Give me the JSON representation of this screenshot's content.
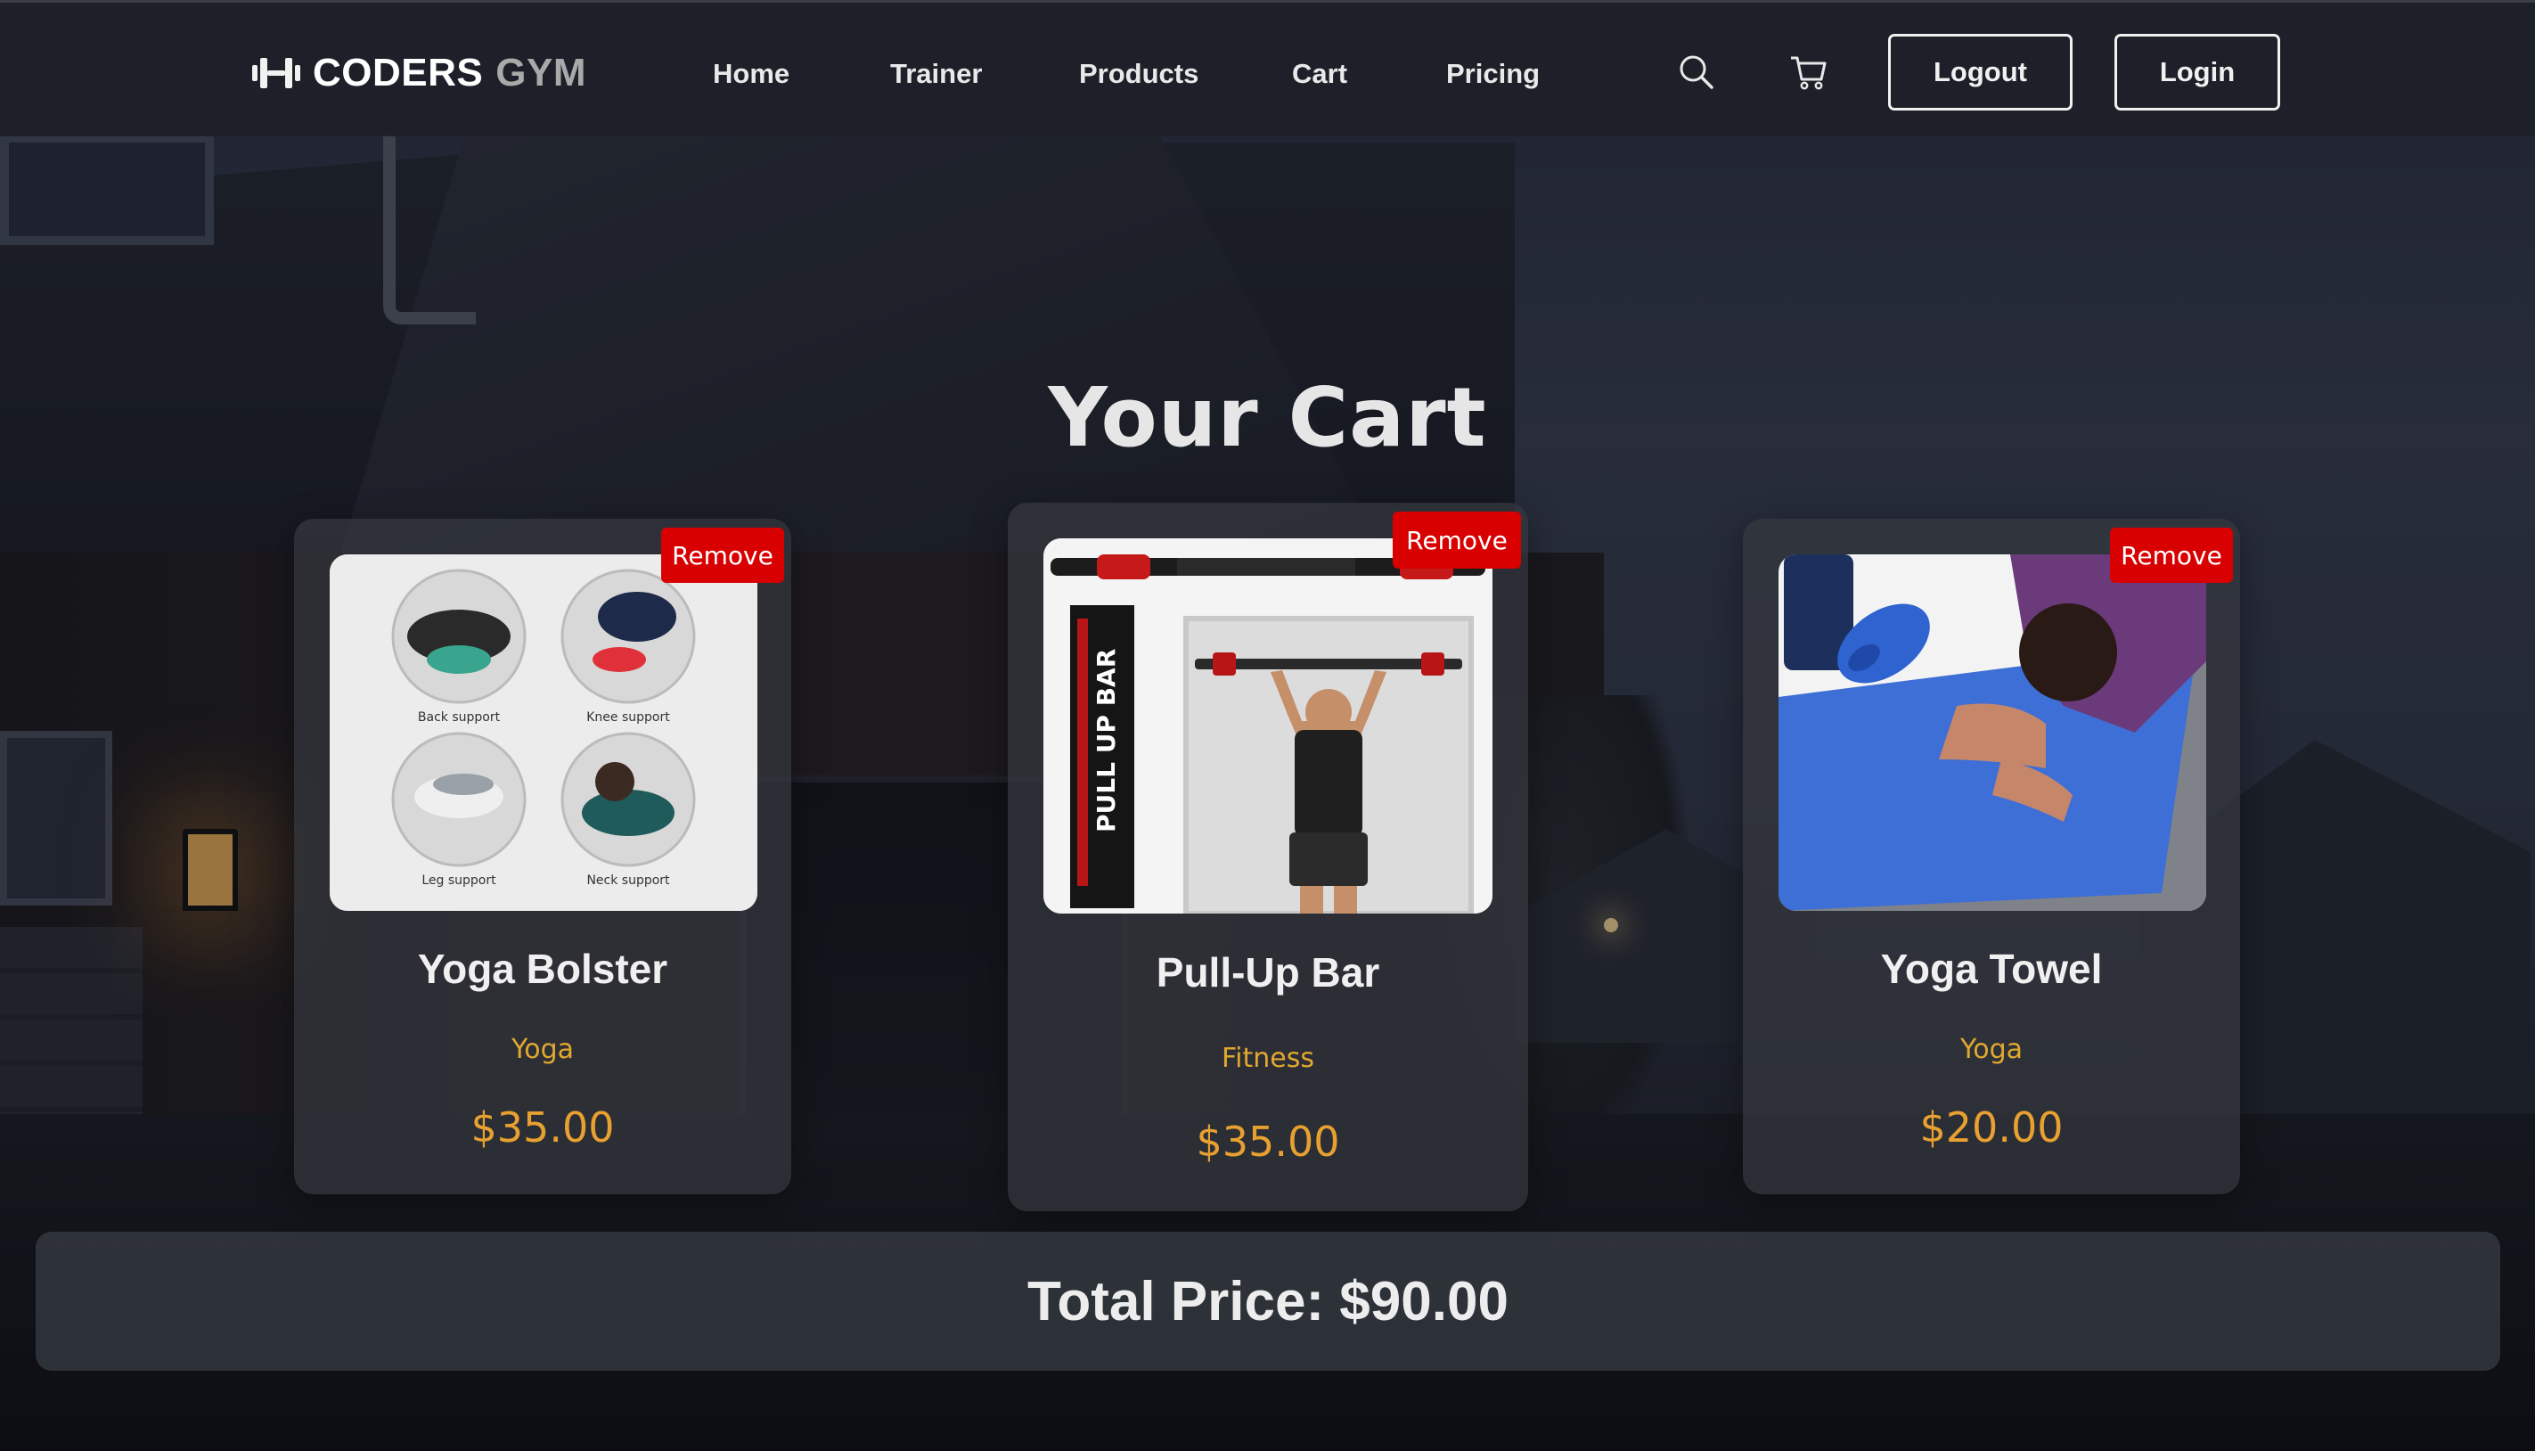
{
  "brand": {
    "word1": "CODERS",
    "word2": "GYM",
    "icon": "dumbbell-icon"
  },
  "nav": {
    "items": [
      {
        "label": "Home"
      },
      {
        "label": "Trainer"
      },
      {
        "label": "Products"
      },
      {
        "label": "Cart"
      },
      {
        "label": "Pricing"
      }
    ],
    "search_icon": "search-icon",
    "cart_icon": "cart-icon",
    "logout_label": "Logout",
    "login_label": "Login"
  },
  "page": {
    "title": "Your Cart"
  },
  "cart": {
    "items": [
      {
        "name": "Yoga Bolster",
        "category": "Yoga",
        "price": "$35.00",
        "remove_label": "Remove",
        "image_captions": [
          "Back support",
          "Knee support",
          "Leg support",
          "Neck support"
        ]
      },
      {
        "name": "Pull-Up Bar",
        "category": "Fitness",
        "price": "$35.00",
        "remove_label": "Remove",
        "image_text": "PULL UP BAR"
      },
      {
        "name": "Yoga Towel",
        "category": "Yoga",
        "price": "$20.00",
        "remove_label": "Remove"
      }
    ],
    "total_label": "Total Price: $90.00"
  },
  "colors": {
    "accent_price": "#e8a030",
    "accent_category": "#e0a82e",
    "remove_button": "#d80000",
    "header_bg": "#1e2028"
  }
}
